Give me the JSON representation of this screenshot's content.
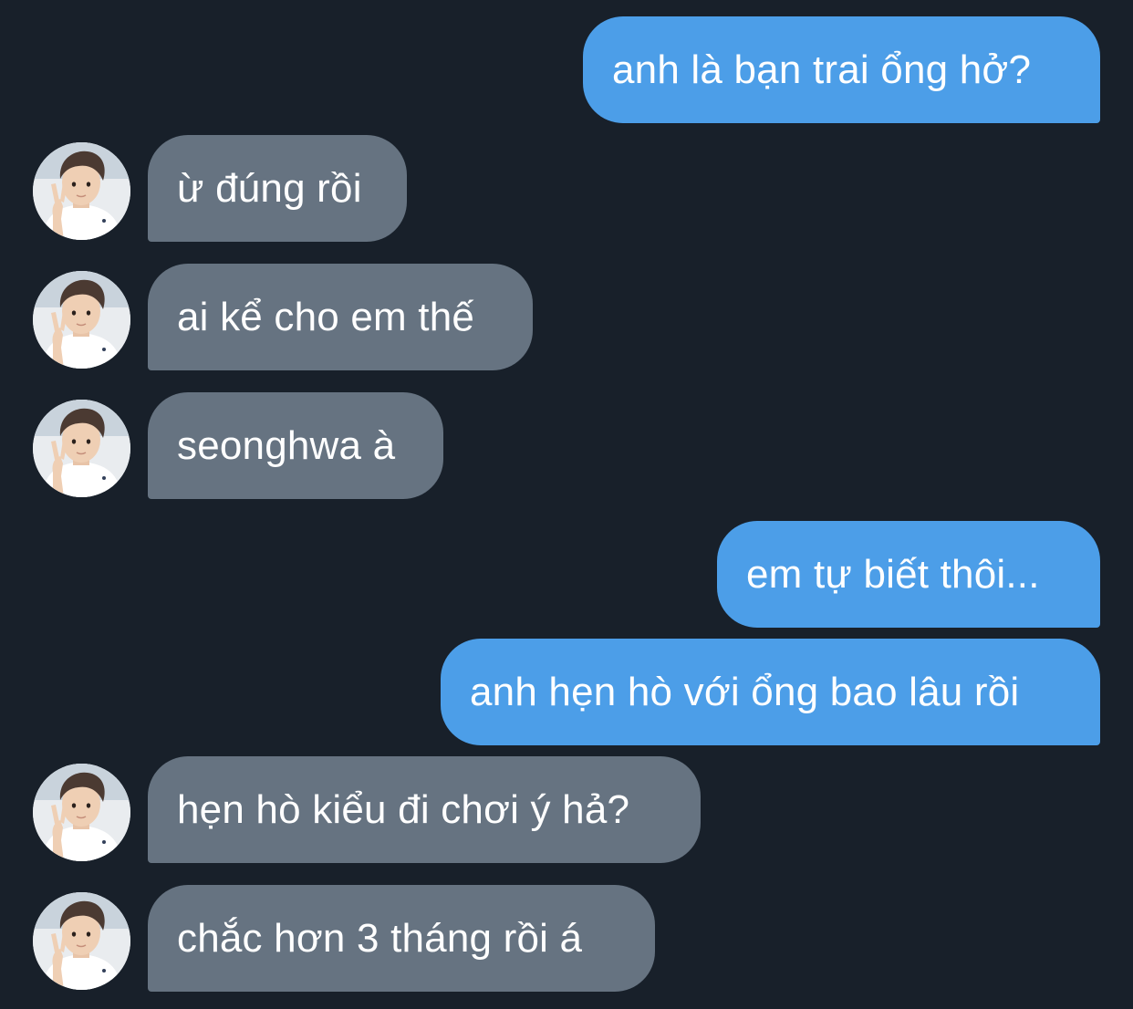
{
  "conversation": {
    "messages": [
      {
        "direction": "outgoing",
        "text": "anh là bạn trai ổng hở?"
      },
      {
        "direction": "incoming",
        "text": "ừ đúng rồi",
        "avatar_icon": "contact-avatar"
      },
      {
        "direction": "incoming",
        "text": "ai kể cho em thế",
        "avatar_icon": "contact-avatar"
      },
      {
        "direction": "incoming",
        "text": "seonghwa à",
        "avatar_icon": "contact-avatar"
      },
      {
        "direction": "outgoing",
        "text": "em tự biết thôi..."
      },
      {
        "direction": "outgoing",
        "text": "anh hẹn hò với ổng bao lâu rồi"
      },
      {
        "direction": "incoming",
        "text": "hẹn hò kiểu đi chơi ý hả?",
        "avatar_icon": "contact-avatar"
      },
      {
        "direction": "incoming",
        "text": "chắc hơn 3 tháng rồi á",
        "avatar_icon": "contact-avatar"
      }
    ]
  },
  "colors": {
    "background": "#18202a",
    "outgoing_bubble": "#4c9ee8",
    "incoming_bubble": "#667381",
    "text": "#ffffff"
  }
}
